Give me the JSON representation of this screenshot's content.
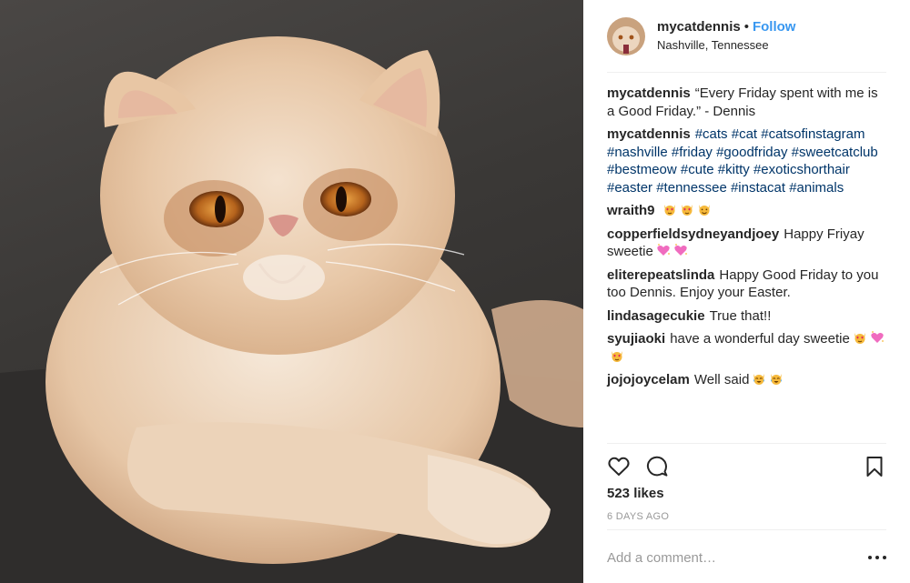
{
  "post": {
    "username": "mycatdennis",
    "separator": "•",
    "follow_label": "Follow",
    "location": "Nashville, Tennessee"
  },
  "caption": {
    "username": "mycatdennis",
    "text": "“Every Friday spent with me is a Good Friday.” - Dennis"
  },
  "hashtag_comment": {
    "username": "mycatdennis",
    "tags": [
      "#cats",
      "#cat",
      "#catsofinstagram",
      "#nashville",
      "#friday",
      "#goodfriday",
      "#sweetcatclub",
      "#bestmeow",
      "#cute",
      "#kitty",
      "#exoticshorthair",
      "#easter",
      "#tennessee",
      "#instacat",
      "#animals"
    ]
  },
  "comments": [
    {
      "username": "wraith9",
      "text": "",
      "emojis": [
        "heart-eyes-cat-emoji",
        "heart-eyes-cat-emoji",
        "smiling-cat-emoji"
      ]
    },
    {
      "username": "copperfieldsydneyandjoey",
      "text": "Happy Friyay sweetie",
      "emojis": [
        "sparkling-heart-emoji",
        "sparkling-heart-emoji"
      ]
    },
    {
      "username": "eliterepeatslinda",
      "text": "Happy Good Friday to you too Dennis. Enjoy your Easter.",
      "emojis": []
    },
    {
      "username": "lindasagecukie",
      "text": "True that!!",
      "emojis": []
    },
    {
      "username": "syujiaoki",
      "text": "have a wonderful day sweetie",
      "emojis": [
        "heart-eyes-cat-emoji",
        "sparkling-heart-emoji",
        "heart-eyes-cat-emoji"
      ]
    },
    {
      "username": "jojojoycelam",
      "text": "Well said",
      "emojis": [
        "tears-of-joy-cat-emoji",
        "tears-of-joy-cat-emoji"
      ]
    }
  ],
  "actions": {
    "like_icon": "heart-outline-icon",
    "comment_icon": "speech-bubble-icon",
    "save_icon": "bookmark-icon"
  },
  "likes": "523 likes",
  "timestamp": "6 DAYS AGO",
  "add_comment": {
    "placeholder": "Add a comment…",
    "more_icon": "more-options-icon"
  },
  "colors": {
    "follow": "#3897f0",
    "hashtag": "#003569",
    "muted": "#999999",
    "text": "#262626",
    "divider": "#efefef"
  }
}
